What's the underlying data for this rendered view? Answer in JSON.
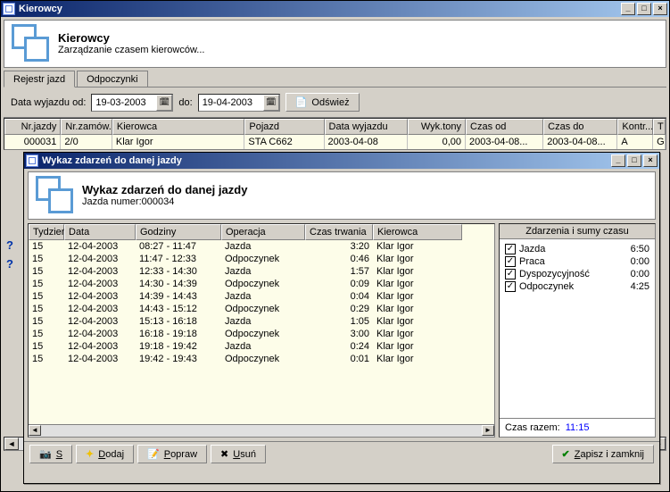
{
  "main": {
    "title": "Kierowcy",
    "header_title": "Kierowcy",
    "header_sub": "Zarządzanie czasem kierowców...",
    "tabs": [
      "Rejestr jazd",
      "Odpoczynki"
    ],
    "filter": {
      "label_from": "Data wyjazdu od:",
      "date_from": "19-03-2003",
      "label_to": "do:",
      "date_to": "19-04-2003",
      "refresh": "Odśwież"
    },
    "cols": {
      "nrj": "Nr.jazdy",
      "nrz": "Nr.zamów.",
      "kier": "Kierowca",
      "poj": "Pojazd",
      "dw": "Data wyjazdu",
      "wt": "Wyk.tony",
      "co": "Czas od",
      "cd": "Czas do",
      "kon": "Kontr...",
      "t": "T"
    },
    "row": {
      "nrj": "000031",
      "nrz": "2/0",
      "kier": "Klar Igor",
      "poj": "STA C662",
      "dw": "2003-04-08",
      "wt": "0,00",
      "co": "2003-04-08...",
      "cd": "2003-04-08...",
      "kon": "A",
      "t": "G"
    }
  },
  "inner": {
    "title": "Wykaz zdarzeń do danej jazdy",
    "header_title": "Wykaz zdarzeń do danej jazdy",
    "header_sub": "Jazda numer:000034",
    "cols": {
      "t": "Tydzień",
      "d": "Data",
      "g": "Godziny",
      "o": "Operacja",
      "ct": "Czas trwania",
      "k": "Kierowca"
    },
    "events": [
      {
        "t": "15",
        "d": "12-04-2003",
        "g": "08:27 - 11:47",
        "o": "Jazda",
        "ct": "3:20",
        "k": "Klar Igor"
      },
      {
        "t": "15",
        "d": "12-04-2003",
        "g": "11:47 - 12:33",
        "o": "Odpoczynek",
        "ct": "0:46",
        "k": "Klar Igor"
      },
      {
        "t": "15",
        "d": "12-04-2003",
        "g": "12:33 - 14:30",
        "o": "Jazda",
        "ct": "1:57",
        "k": "Klar Igor"
      },
      {
        "t": "15",
        "d": "12-04-2003",
        "g": "14:30 - 14:39",
        "o": "Odpoczynek",
        "ct": "0:09",
        "k": "Klar Igor"
      },
      {
        "t": "15",
        "d": "12-04-2003",
        "g": "14:39 - 14:43",
        "o": "Jazda",
        "ct": "0:04",
        "k": "Klar Igor"
      },
      {
        "t": "15",
        "d": "12-04-2003",
        "g": "14:43 - 15:12",
        "o": "Odpoczynek",
        "ct": "0:29",
        "k": "Klar Igor"
      },
      {
        "t": "15",
        "d": "12-04-2003",
        "g": "15:13 - 16:18",
        "o": "Jazda",
        "ct": "1:05",
        "k": "Klar Igor"
      },
      {
        "t": "15",
        "d": "12-04-2003",
        "g": "16:18 - 19:18",
        "o": "Odpoczynek",
        "ct": "3:00",
        "k": "Klar Igor"
      },
      {
        "t": "15",
        "d": "12-04-2003",
        "g": "19:18 - 19:42",
        "o": "Jazda",
        "ct": "0:24",
        "k": "Klar Igor"
      },
      {
        "t": "15",
        "d": "12-04-2003",
        "g": "19:42 - 19:43",
        "o": "Odpoczynek",
        "ct": "0:01",
        "k": "Klar Igor"
      }
    ],
    "sums_title": "Zdarzenia i sumy czasu",
    "sums": [
      {
        "label": "Jazda",
        "value": "6:50"
      },
      {
        "label": "Praca",
        "value": "0:00"
      },
      {
        "label": "Dyspozycyjność",
        "value": "0:00"
      },
      {
        "label": "Odpoczynek",
        "value": "4:25"
      }
    ],
    "total_label": "Czas razem:",
    "total_value": "11:15",
    "buttons": {
      "skanuj": "Skanuj",
      "dodaj": "Dodaj",
      "popraw": "Popraw",
      "usun": "Usuń",
      "zapisz": "Zapisz i zamknij"
    }
  }
}
